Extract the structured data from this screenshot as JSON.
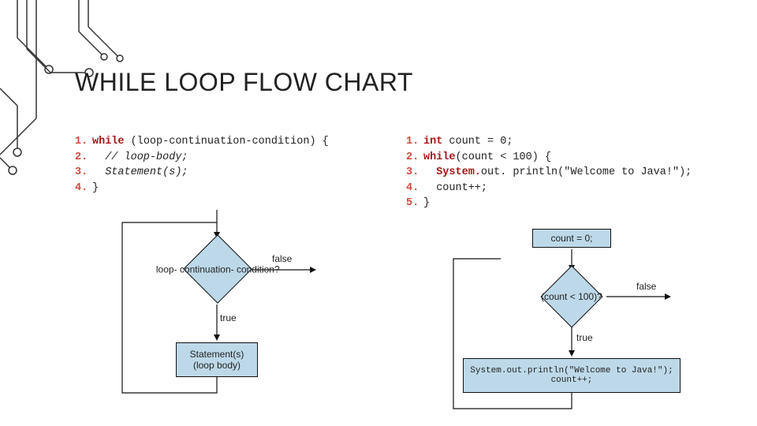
{
  "title": "WHILE LOOP FLOW CHART",
  "left": {
    "code": {
      "kw_while": "while",
      "l1_rest": "(loop-continuation-condition) {",
      "l2": "// loop-body;",
      "l3": "Statement(s);",
      "l4": "}"
    },
    "flow": {
      "cond": "loop-\ncontinuation-\ncondition?",
      "body": "Statement(s)\n(loop body)",
      "true": "true",
      "false": "false"
    }
  },
  "right": {
    "code": {
      "kw_int": "int",
      "l1_rest": "count = 0;",
      "kw_while": "while",
      "l2_rest": "(count < 100) {",
      "kw_system": "System.",
      "l3_rest": "out. println(\"Welcome to Java!\");",
      "l4": "count++;",
      "l5": "}"
    },
    "flow": {
      "init": "count = 0;",
      "cond": "(count < 100)?",
      "body": "System.out.println(\"Welcome to Java!\");\ncount++;",
      "true": "true",
      "false": "false"
    }
  }
}
